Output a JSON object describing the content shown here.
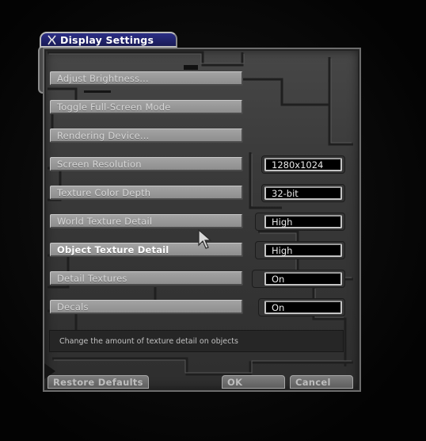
{
  "window": {
    "title": "Display Settings",
    "icon": "options-icon"
  },
  "settings": [
    {
      "label": "Adjust Brightness..."
    },
    {
      "label": "Toggle Full-Screen Mode"
    },
    {
      "label": "Rendering Device..."
    },
    {
      "label": "Screen Resolution",
      "value": "1280x1024"
    },
    {
      "label": "Texture Color Depth",
      "value": "32-bit"
    },
    {
      "label": "World Texture Detail",
      "value": "High"
    },
    {
      "label": "Object Texture Detail",
      "value": "High",
      "active": true
    },
    {
      "label": "Detail Textures",
      "value": "On"
    },
    {
      "label": "Decals",
      "value": "On"
    }
  ],
  "help_text": "Change the amount of texture detail on objects",
  "footer": {
    "restore": "Restore Defaults",
    "ok": "OK",
    "cancel": "Cancel"
  },
  "colors": {
    "title_bar": "#24267a",
    "button": "#9a9a9a",
    "value_box": "#000000"
  }
}
